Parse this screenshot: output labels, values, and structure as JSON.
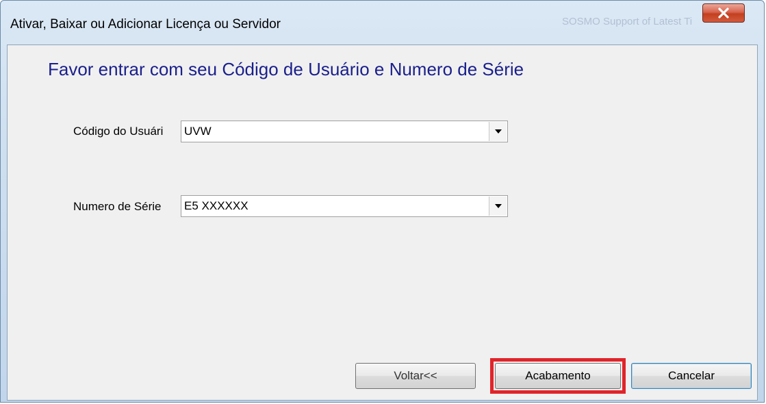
{
  "window": {
    "title": "Ativar, Baixar ou Adicionar Licença ou Servidor",
    "background_ghost_text": "SOSMO Support of Latest Ti"
  },
  "titlebar": {
    "close_icon": "close-x-icon",
    "close_color": "#c2401f"
  },
  "form": {
    "heading": "Favor entrar com seu Código de Usuário e Numero de Série",
    "heading_color": "#1a1f8c",
    "user_code": {
      "label": "Código do Usuári",
      "value": "UVW",
      "dropdown_icon": "chevron-down-icon"
    },
    "serial_number": {
      "label": "Numero de Série",
      "value": "E5 XXXXXX",
      "dropdown_icon": "chevron-down-icon"
    }
  },
  "buttons": {
    "back": "Voltar<<",
    "finish": "Acabamento",
    "cancel": "Cancelar"
  },
  "annotation": {
    "highlight_color": "#e0242a",
    "highlighted_button": "Acabamento"
  }
}
